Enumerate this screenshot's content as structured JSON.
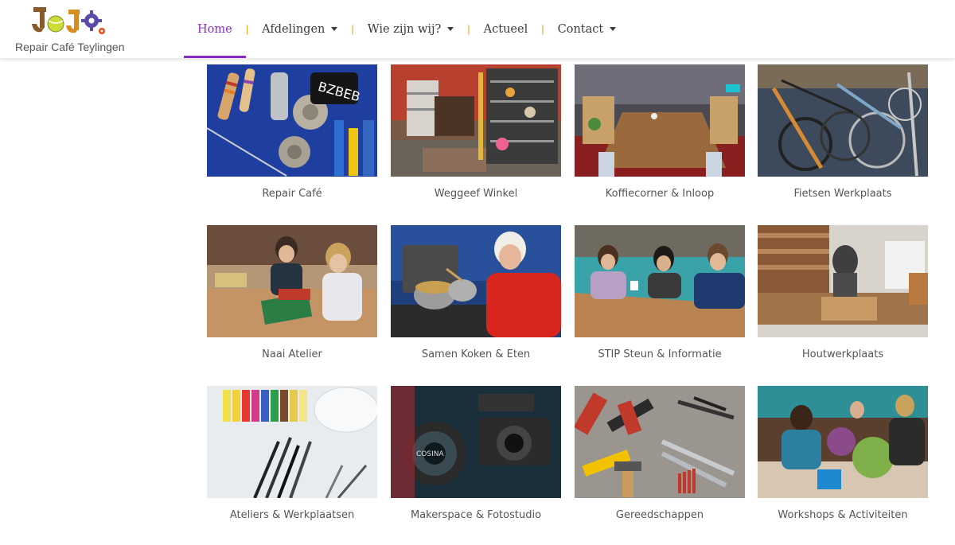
{
  "brand": {
    "name": "Repair Café Teylingen",
    "logo_letters": "JOJO"
  },
  "nav": {
    "items": [
      {
        "label": "Home",
        "active": true,
        "dropdown": false
      },
      {
        "label": "Afdelingen",
        "active": false,
        "dropdown": true
      },
      {
        "label": "Wie zijn wij?",
        "active": false,
        "dropdown": true
      },
      {
        "label": "Actueel",
        "active": false,
        "dropdown": false
      },
      {
        "label": "Contact",
        "active": false,
        "dropdown": true
      }
    ],
    "separator": "|"
  },
  "colors": {
    "accent": "#8a2bc9",
    "separator": "#e9a11d",
    "text": "#555555"
  },
  "cards": [
    {
      "label": "Repair Café",
      "image": "electronic-components-photo"
    },
    {
      "label": "Weggeef Winkel",
      "image": "shop-shelves-photo"
    },
    {
      "label": "Koffiecorner & Inloop",
      "image": "cafe-table-photo"
    },
    {
      "label": "Fietsen Werkplaats",
      "image": "bicycles-photo"
    },
    {
      "label": "Naai Atelier",
      "image": "sewing-women-photo"
    },
    {
      "label": "Samen Koken & Eten",
      "image": "cooking-woman-photo"
    },
    {
      "label": "STIP Steun & Informatie",
      "image": "women-at-table-photo"
    },
    {
      "label": "Houtwerkplaats",
      "image": "wood-workshop-photo"
    },
    {
      "label": "Ateliers & Werkplaatsen",
      "image": "paint-brushes-photo"
    },
    {
      "label": "Makerspace & Fotostudio",
      "image": "cameras-photo"
    },
    {
      "label": "Gereedschappen",
      "image": "tools-photo"
    },
    {
      "label": "Workshops & Activiteiten",
      "image": "workshop-people-photo"
    }
  ]
}
